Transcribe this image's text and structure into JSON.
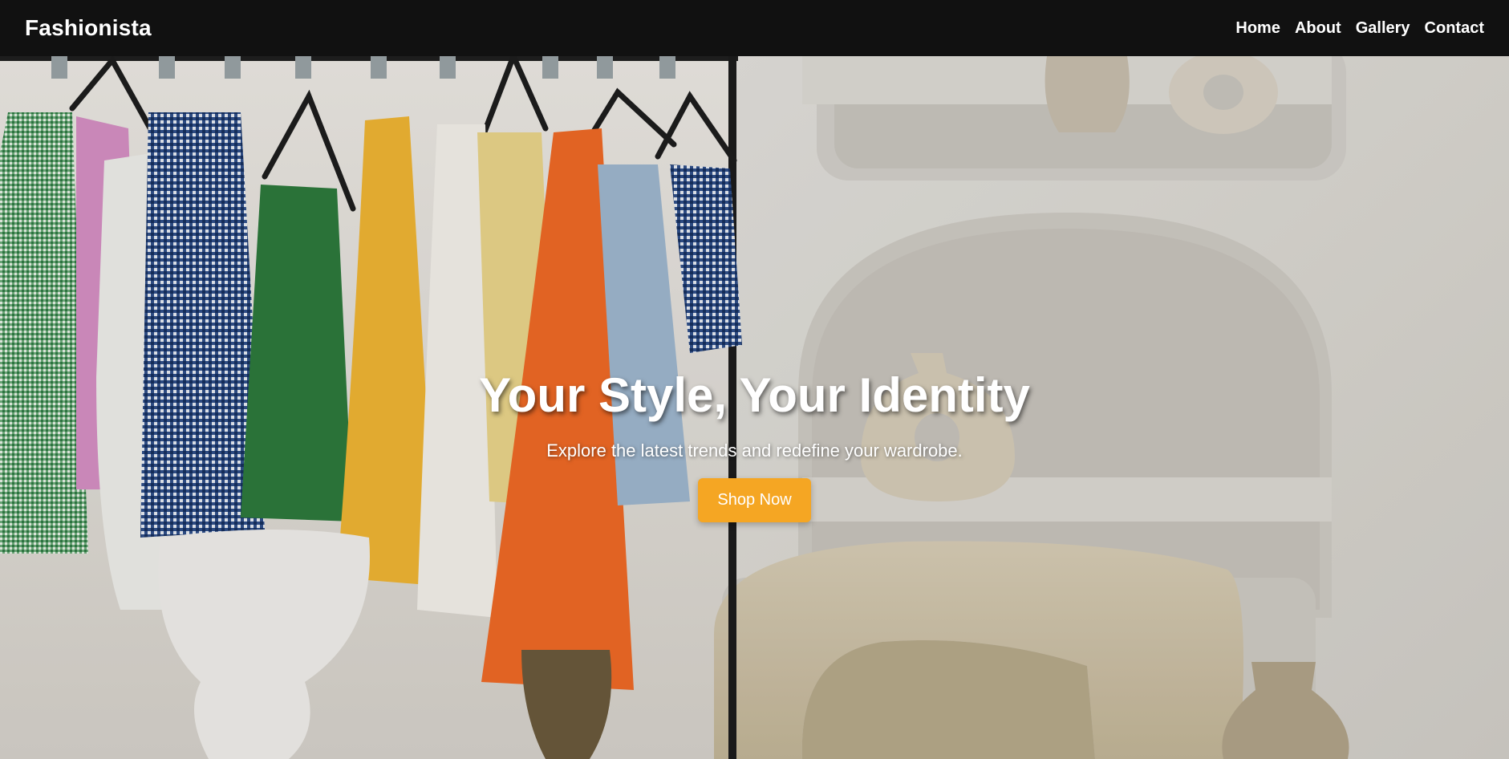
{
  "navbar": {
    "brand": "Fashionista",
    "links": [
      {
        "label": "Home"
      },
      {
        "label": "About"
      },
      {
        "label": "Gallery"
      },
      {
        "label": "Contact"
      }
    ]
  },
  "hero": {
    "title": "Your Style, Your Identity",
    "subtitle": "Explore the latest trends and redefine your wardrobe.",
    "cta_label": "Shop Now"
  },
  "colors": {
    "navbar_bg": "#111111",
    "accent": "#f5a623",
    "text": "#ffffff"
  }
}
